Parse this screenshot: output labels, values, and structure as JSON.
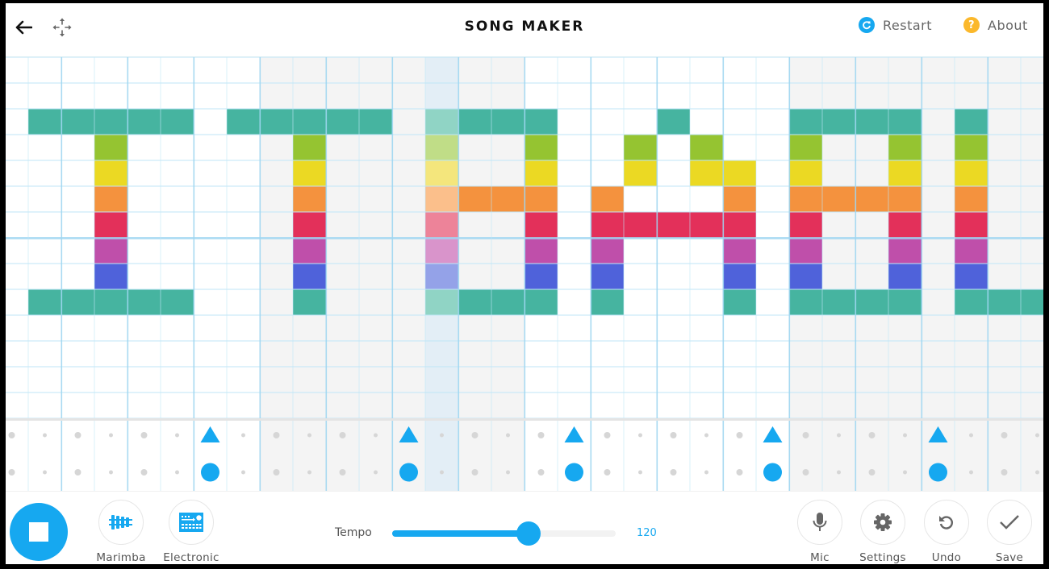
{
  "header": {
    "title": "SONG MAKER",
    "back_icon": "arrow-left-icon",
    "move_icon": "move-arrows-icon",
    "restart_label": "Restart",
    "about_label": "About",
    "restart_icon": "refresh-icon",
    "about_icon": "question-icon",
    "about_glyph": "?"
  },
  "colors": {
    "accent": "#16a8f0",
    "about": "#fbb82b",
    "bar_shade": "#f4f4f4",
    "playhead": "#e3eef6",
    "grid_line": "#bfe6f7",
    "grid_line_strong": "#9fd6f1",
    "rhythm_dot": "#d6d6d6",
    "note_colors": [
      "#46b4a0",
      "#95c431",
      "#ebd923",
      "#f4923e",
      "#e3305a",
      "#bf4faa",
      "#4f62da",
      "#46b4a0"
    ],
    "note_colors_highlight": [
      "#90d4c5",
      "#c0dd87",
      "#f4e67c",
      "#fbbf8b",
      "#ed8399",
      "#d994cb",
      "#94a2e8",
      "#90d4c5"
    ]
  },
  "song": {
    "columns": 32,
    "beats_per_bar": 8,
    "melody_rows": 14,
    "playhead_column": 13,
    "melody_notes": [
      [
        1,
        2
      ],
      [
        2,
        2
      ],
      [
        3,
        2
      ],
      [
        4,
        2
      ],
      [
        5,
        2
      ],
      [
        3,
        3
      ],
      [
        3,
        4
      ],
      [
        3,
        5
      ],
      [
        3,
        6
      ],
      [
        3,
        7
      ],
      [
        3,
        8
      ],
      [
        1,
        9
      ],
      [
        2,
        9
      ],
      [
        3,
        9
      ],
      [
        4,
        9
      ],
      [
        5,
        9
      ],
      [
        7,
        2
      ],
      [
        8,
        2
      ],
      [
        9,
        2
      ],
      [
        10,
        2
      ],
      [
        11,
        2
      ],
      [
        9,
        3
      ],
      [
        9,
        4
      ],
      [
        9,
        5
      ],
      [
        9,
        6
      ],
      [
        9,
        7
      ],
      [
        9,
        8
      ],
      [
        9,
        9
      ],
      [
        13,
        2
      ],
      [
        13,
        3
      ],
      [
        13,
        4
      ],
      [
        13,
        5
      ],
      [
        13,
        6
      ],
      [
        13,
        7
      ],
      [
        13,
        8
      ],
      [
        13,
        9
      ],
      [
        14,
        2
      ],
      [
        15,
        2
      ],
      [
        16,
        2
      ],
      [
        16,
        3
      ],
      [
        16,
        4
      ],
      [
        16,
        5
      ],
      [
        16,
        6
      ],
      [
        16,
        7
      ],
      [
        16,
        8
      ],
      [
        16,
        9
      ],
      [
        14,
        5
      ],
      [
        15,
        5
      ],
      [
        14,
        9
      ],
      [
        15,
        9
      ],
      [
        18,
        5
      ],
      [
        18,
        6
      ],
      [
        18,
        7
      ],
      [
        18,
        8
      ],
      [
        18,
        9
      ],
      [
        19,
        3
      ],
      [
        19,
        4
      ],
      [
        19,
        6
      ],
      [
        20,
        2
      ],
      [
        20,
        6
      ],
      [
        21,
        3
      ],
      [
        21,
        4
      ],
      [
        21,
        6
      ],
      [
        22,
        4
      ],
      [
        22,
        5
      ],
      [
        22,
        6
      ],
      [
        22,
        7
      ],
      [
        22,
        8
      ],
      [
        22,
        9
      ],
      [
        24,
        2
      ],
      [
        24,
        3
      ],
      [
        24,
        4
      ],
      [
        24,
        5
      ],
      [
        24,
        6
      ],
      [
        24,
        7
      ],
      [
        24,
        8
      ],
      [
        24,
        9
      ],
      [
        25,
        2
      ],
      [
        26,
        2
      ],
      [
        27,
        2
      ],
      [
        27,
        3
      ],
      [
        27,
        4
      ],
      [
        27,
        5
      ],
      [
        27,
        6
      ],
      [
        27,
        7
      ],
      [
        27,
        8
      ],
      [
        27,
        9
      ],
      [
        25,
        5
      ],
      [
        26,
        5
      ],
      [
        25,
        9
      ],
      [
        26,
        9
      ],
      [
        29,
        2
      ],
      [
        29,
        3
      ],
      [
        29,
        4
      ],
      [
        29,
        5
      ],
      [
        29,
        6
      ],
      [
        29,
        7
      ],
      [
        29,
        8
      ],
      [
        29,
        9
      ],
      [
        30,
        9
      ],
      [
        31,
        9
      ]
    ],
    "rhythm_triangles": [
      6,
      12,
      17,
      23,
      28
    ],
    "rhythm_circles": [
      6,
      12,
      17,
      23,
      28
    ]
  },
  "toolbar": {
    "play_state": "playing",
    "play_icon": "stop-icon",
    "instruments": [
      {
        "label": "Marimba",
        "icon": "marimba-icon"
      },
      {
        "label": "Electronic",
        "icon": "drum-machine-icon"
      }
    ],
    "tempo_label": "Tempo",
    "tempo_value": "120",
    "tempo_fraction": 0.61,
    "actions": [
      {
        "label": "Mic",
        "icon": "microphone-icon"
      },
      {
        "label": "Settings",
        "icon": "gear-icon"
      },
      {
        "label": "Undo",
        "icon": "undo-icon"
      },
      {
        "label": "Save",
        "icon": "checkmark-icon"
      }
    ]
  }
}
